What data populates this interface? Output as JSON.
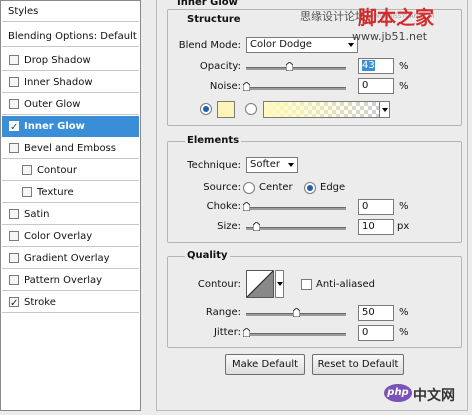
{
  "sidebar": {
    "header": "Styles",
    "blending": "Blending Options: Default",
    "items": [
      {
        "label": "Drop Shadow",
        "checked": false
      },
      {
        "label": "Inner Shadow",
        "checked": false
      },
      {
        "label": "Outer Glow",
        "checked": false
      },
      {
        "label": "Inner Glow",
        "checked": true,
        "selected": true
      },
      {
        "label": "Bevel and Emboss",
        "checked": false
      },
      {
        "label": "Contour",
        "checked": false,
        "indent": true
      },
      {
        "label": "Texture",
        "checked": false,
        "indent": true
      },
      {
        "label": "Satin",
        "checked": false
      },
      {
        "label": "Color Overlay",
        "checked": false
      },
      {
        "label": "Gradient Overlay",
        "checked": false
      },
      {
        "label": "Pattern Overlay",
        "checked": false
      },
      {
        "label": "Stroke",
        "checked": true
      }
    ]
  },
  "panel": {
    "title": "Inner Glow",
    "structure": {
      "title": "Structure",
      "blend_mode_label": "Blend Mode:",
      "blend_mode_value": "Color Dodge",
      "opacity_label": "Opacity:",
      "opacity_value": "43",
      "opacity_unit": "%",
      "noise_label": "Noise:",
      "noise_value": "0",
      "noise_unit": "%",
      "glow_color": "#fff4b8",
      "use_solid_color": true
    },
    "elements": {
      "title": "Elements",
      "technique_label": "Technique:",
      "technique_value": "Softer",
      "source_label": "Source:",
      "source_center": "Center",
      "source_edge": "Edge",
      "source_selected": "Edge",
      "choke_label": "Choke:",
      "choke_value": "0",
      "choke_unit": "%",
      "size_label": "Size:",
      "size_value": "10",
      "size_unit": "px"
    },
    "quality": {
      "title": "Quality",
      "contour_label": "Contour:",
      "anti_aliased_label": "Anti-aliased",
      "anti_aliased": false,
      "range_label": "Range:",
      "range_value": "50",
      "range_unit": "%",
      "jitter_label": "Jitter:",
      "jitter_value": "0",
      "jitter_unit": "%"
    },
    "buttons": {
      "make_default": "Make Default",
      "reset_default": "Reset to Default"
    }
  },
  "watermarks": {
    "top_cn": "思缘设计论坛",
    "top_faint": "WWW.MISSYUAN.COM",
    "site_cn": "脚本之家",
    "site_url": "www.jb51.net",
    "php_logo": "php",
    "php_cn": "中文网"
  },
  "colors": {
    "selection": "#3a8ed8",
    "watermark_red": "#d42a2a",
    "php_purple": "#7a52b8"
  }
}
